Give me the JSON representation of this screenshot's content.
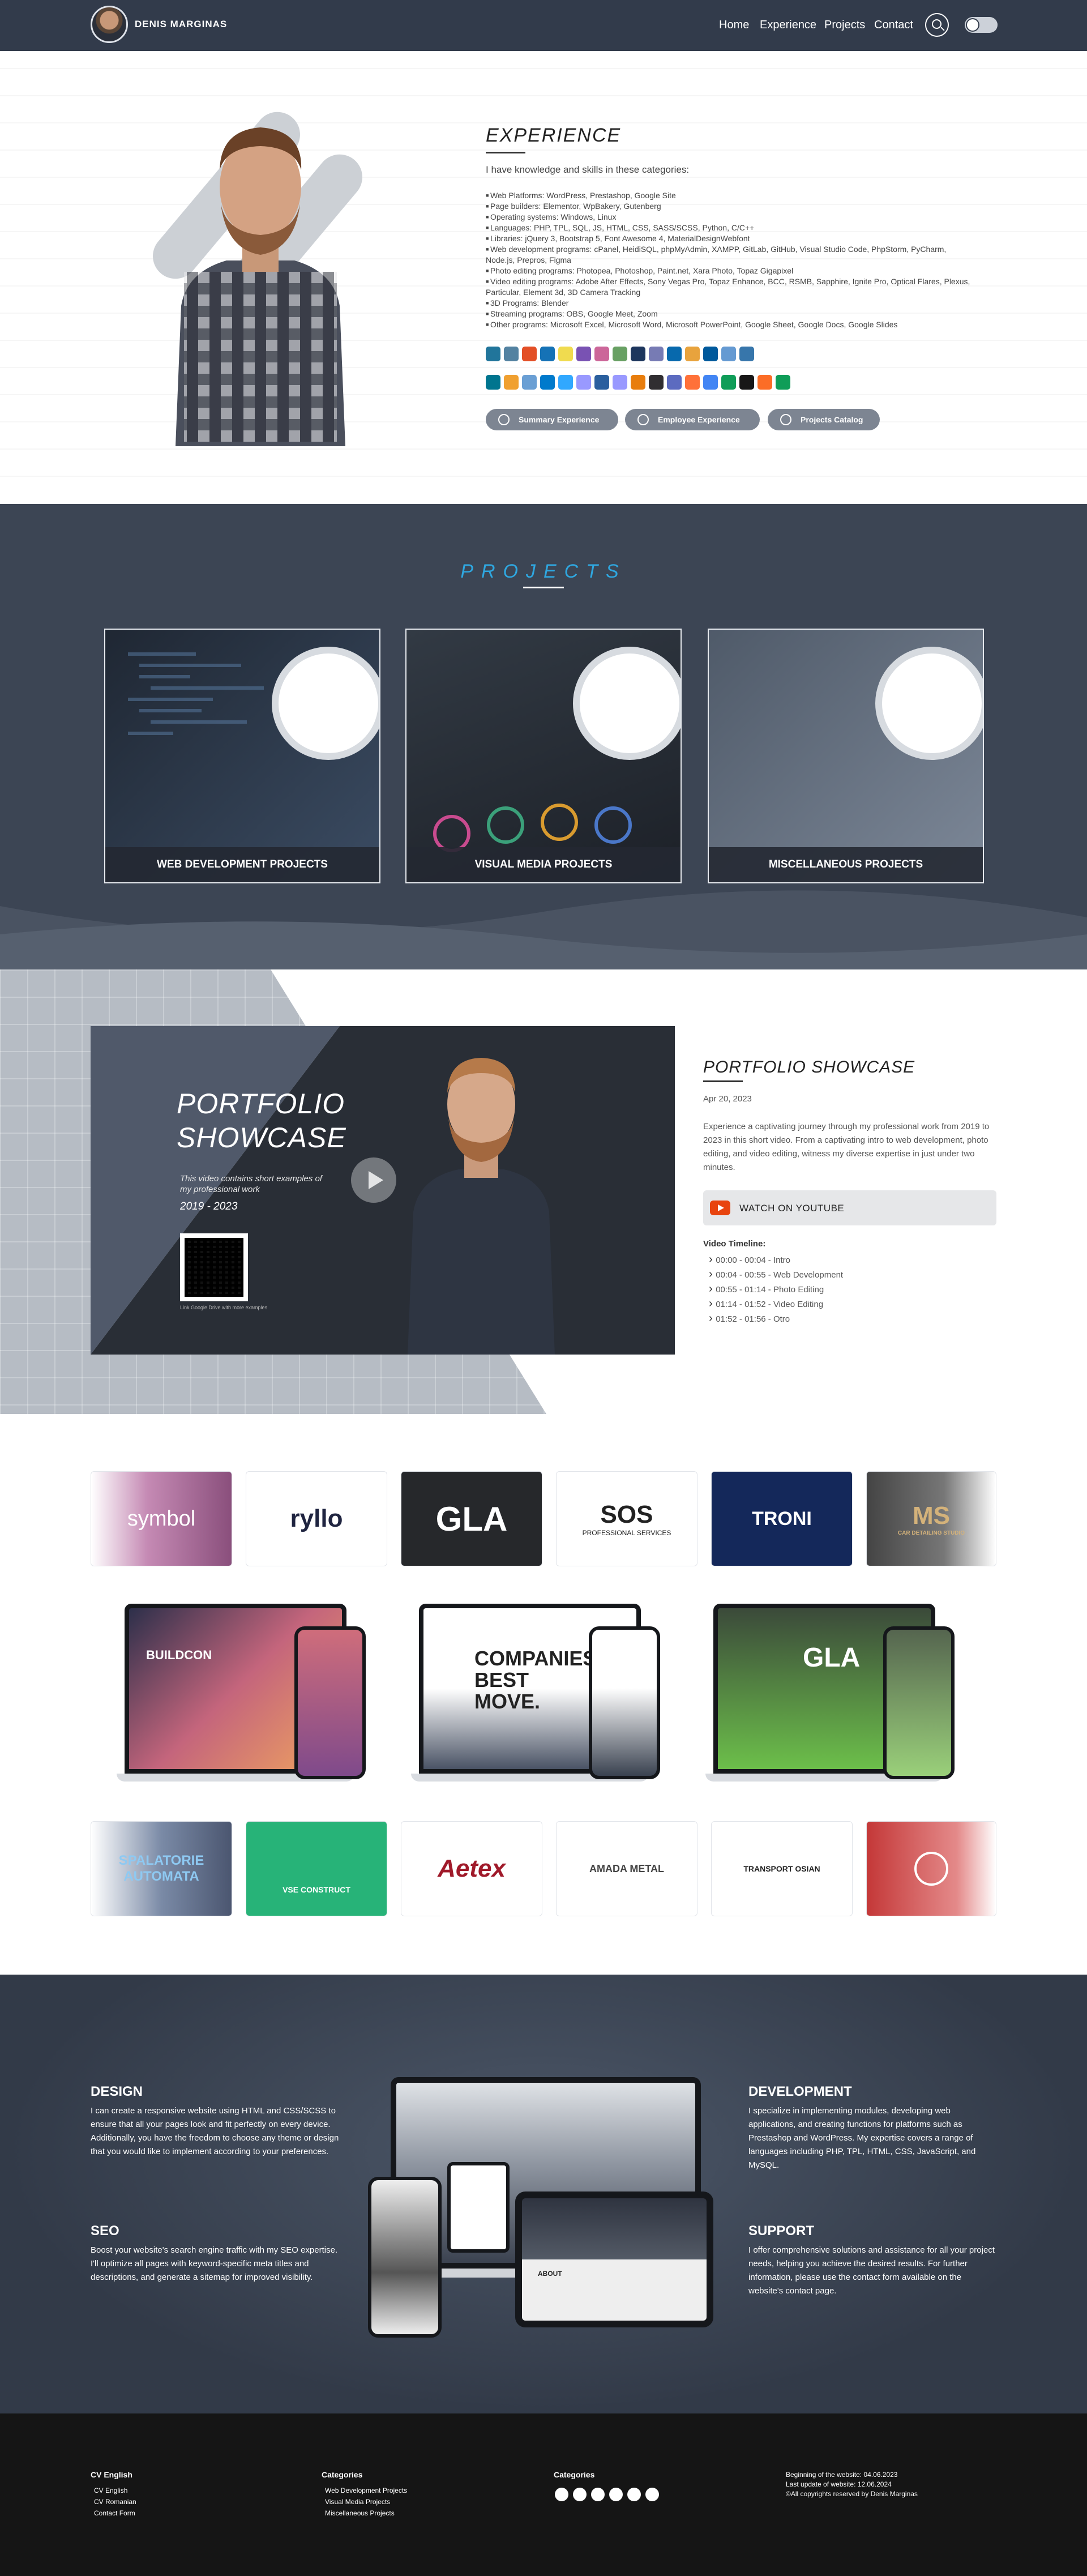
{
  "nav": {
    "brand": "DENIS MARGINAS",
    "links": [
      "Home",
      "Experience",
      "Projects",
      "Contact"
    ]
  },
  "experience": {
    "title": "EXPERIENCE",
    "intro": "I have knowledge and skills in these categories:",
    "items": [
      "Web Platforms: WordPress, Prestashop, Google Site",
      "Page builders: Elementor, WpBakery, Gutenberg",
      "Operating systems: Windows, Linux",
      "Languages: PHP, TPL, SQL, JS, HTML, CSS, SASS/SCSS, Python, C/C++",
      "Libraries: jQuery 3, Bootstrap 5, Font Awesome 4, MaterialDesignWebfont",
      "Web development programs: cPanel, HeidiSQL, phpMyAdmin, XAMPP, GitLab, GitHub, Visual Studio Code, PhpStorm, PyCharm, Node.js, Prepros, Figma",
      "Photo editing programs: Photopea, Photoshop, Paint.net, Xara Photo, Topaz Gigapixel",
      "Video editing programs: Adobe After Effects, Sony Vegas Pro, Topaz Enhance, BCC, RSMB, Sapphire, Ignite Pro, Optical Flares, Plexus, Particular, Element 3d, 3D Camera Tracking",
      "3D Programs: Blender",
      "Streaming programs: OBS, Google Meet, Zoom",
      "Other programs: Microsoft Excel, Microsoft Word, Microsoft PowerPoint, Google Sheet, Google Docs, Google Slides"
    ],
    "tech_icons_row1": [
      "wordpress-icon",
      "joomla-icon",
      "html5-icon",
      "css3-icon",
      "js-icon",
      "bootstrap-icon",
      "sass-icon",
      "nodejs-icon",
      "less-icon",
      "php-icon",
      "jquery-icon",
      "folder-icon",
      "c-icon",
      "cpp-icon",
      "python-icon"
    ],
    "tech_icons_row2": [
      "mysql-icon",
      "chart-icon",
      "bar-icon",
      "vscode-icon",
      "ps-icon",
      "pr-icon",
      "vegas-icon",
      "ae-icon",
      "blender-icon",
      "obs-icon",
      "mic-icon",
      "firefox-icon",
      "chrome-icon",
      "drive-icon",
      "github-icon",
      "gitlab-icon",
      "sheet-icon"
    ],
    "buttons": [
      "Summary Experience",
      "Employee Experience",
      "Projects Catalog"
    ]
  },
  "projects": {
    "title": "PROJECTS",
    "cards": [
      "WEB DEVELOPMENT PROJECTS",
      "VISUAL MEDIA PROJECTS",
      "MISCELLANEOUS PROJECTS"
    ]
  },
  "showcase": {
    "video_title_1": "PORTFOLIO",
    "video_title_2": "SHOWCASE",
    "video_sub": "This video contains short examples of my professional work",
    "video_years": "2019 - 2023",
    "qr_caption": "Link Google Drive with more examples",
    "title": "PORTFOLIO SHOWCASE",
    "date": "Apr 20, 2023",
    "description": "Experience a captivating journey through my professional work from 2019 to 2023 in this short video. From a captivating intro to web development, photo editing, and video editing, witness my diverse expertise in just under two minutes.",
    "youtube_label": "WATCH ON YOUTUBE",
    "timeline_title": "Video Timeline:",
    "timeline": [
      "00:00 - 00:04 - Intro",
      "00:04 - 00:55 - Web Development",
      "00:55 - 01:14 - Photo Editing",
      "01:14 - 01:52 - Video Editing",
      "01:52 - 01:56 - Otro"
    ]
  },
  "clients": {
    "row1": [
      "symbol",
      "ryllo",
      "GLA",
      "SOS",
      "TRONI",
      "MS"
    ],
    "row1_sub": [
      "",
      "",
      "",
      "PROFESSIONAL SERVICES",
      "",
      "CAR DETAILING STUDIO"
    ],
    "mock1_title": "BUILDCON",
    "mock2_title": "COMPANIES BEST MOVE.",
    "mock3_title": "GLA",
    "row2": [
      "SPALATORIE AUTOMATA",
      "VSE CONSTRUCT",
      "Aetex",
      "AMADA METAL",
      "TRANSPORT OSIAN",
      ""
    ]
  },
  "services": {
    "design_title": "DESIGN",
    "design_text": "I can create a responsive website using HTML and CSS/SCSS to ensure that all your pages look and fit perfectly on every device. Additionally, you have the freedom to choose any theme or design that you would like to implement according to your preferences.",
    "seo_title": "SEO",
    "seo_text": "Boost your website's search engine traffic with my SEO expertise. I'll optimize all pages with keyword-specific meta titles and descriptions, and generate a sitemap for improved visibility.",
    "dev_title": "DEVELOPMENT",
    "dev_text": "I specialize in implementing modules, developing web applications, and creating functions for platforms such as Prestashop and WordPress. My expertise covers a range of languages including PHP, TPL, HTML, CSS, JavaScript, and MySQL.",
    "support_title": "SUPPORT",
    "support_text": "I offer comprehensive solutions and assistance for all your project needs, helping you achieve the desired results. For further information, please use the contact form available on the website's contact page.",
    "mock_about": "ABOUT"
  },
  "footer": {
    "col1_title": "CV English",
    "col1_items": [
      "CV English",
      "CV Romanian",
      "Contact Form"
    ],
    "col2_title": "Categories",
    "col2_items": [
      "Web Development Projects",
      "Visual Media Projects",
      "Miscellaneous Projects"
    ],
    "col3_title": "Categories",
    "social_icons": [
      "email-icon",
      "facebook-icon",
      "linkedin-icon",
      "x-icon",
      "instagram-icon",
      "github-icon"
    ],
    "info": [
      "Beginning of the website: 04.06.2023",
      "Last update of website: 12.06.2024",
      "©All copyrights reserved by Denis Marginas"
    ]
  }
}
